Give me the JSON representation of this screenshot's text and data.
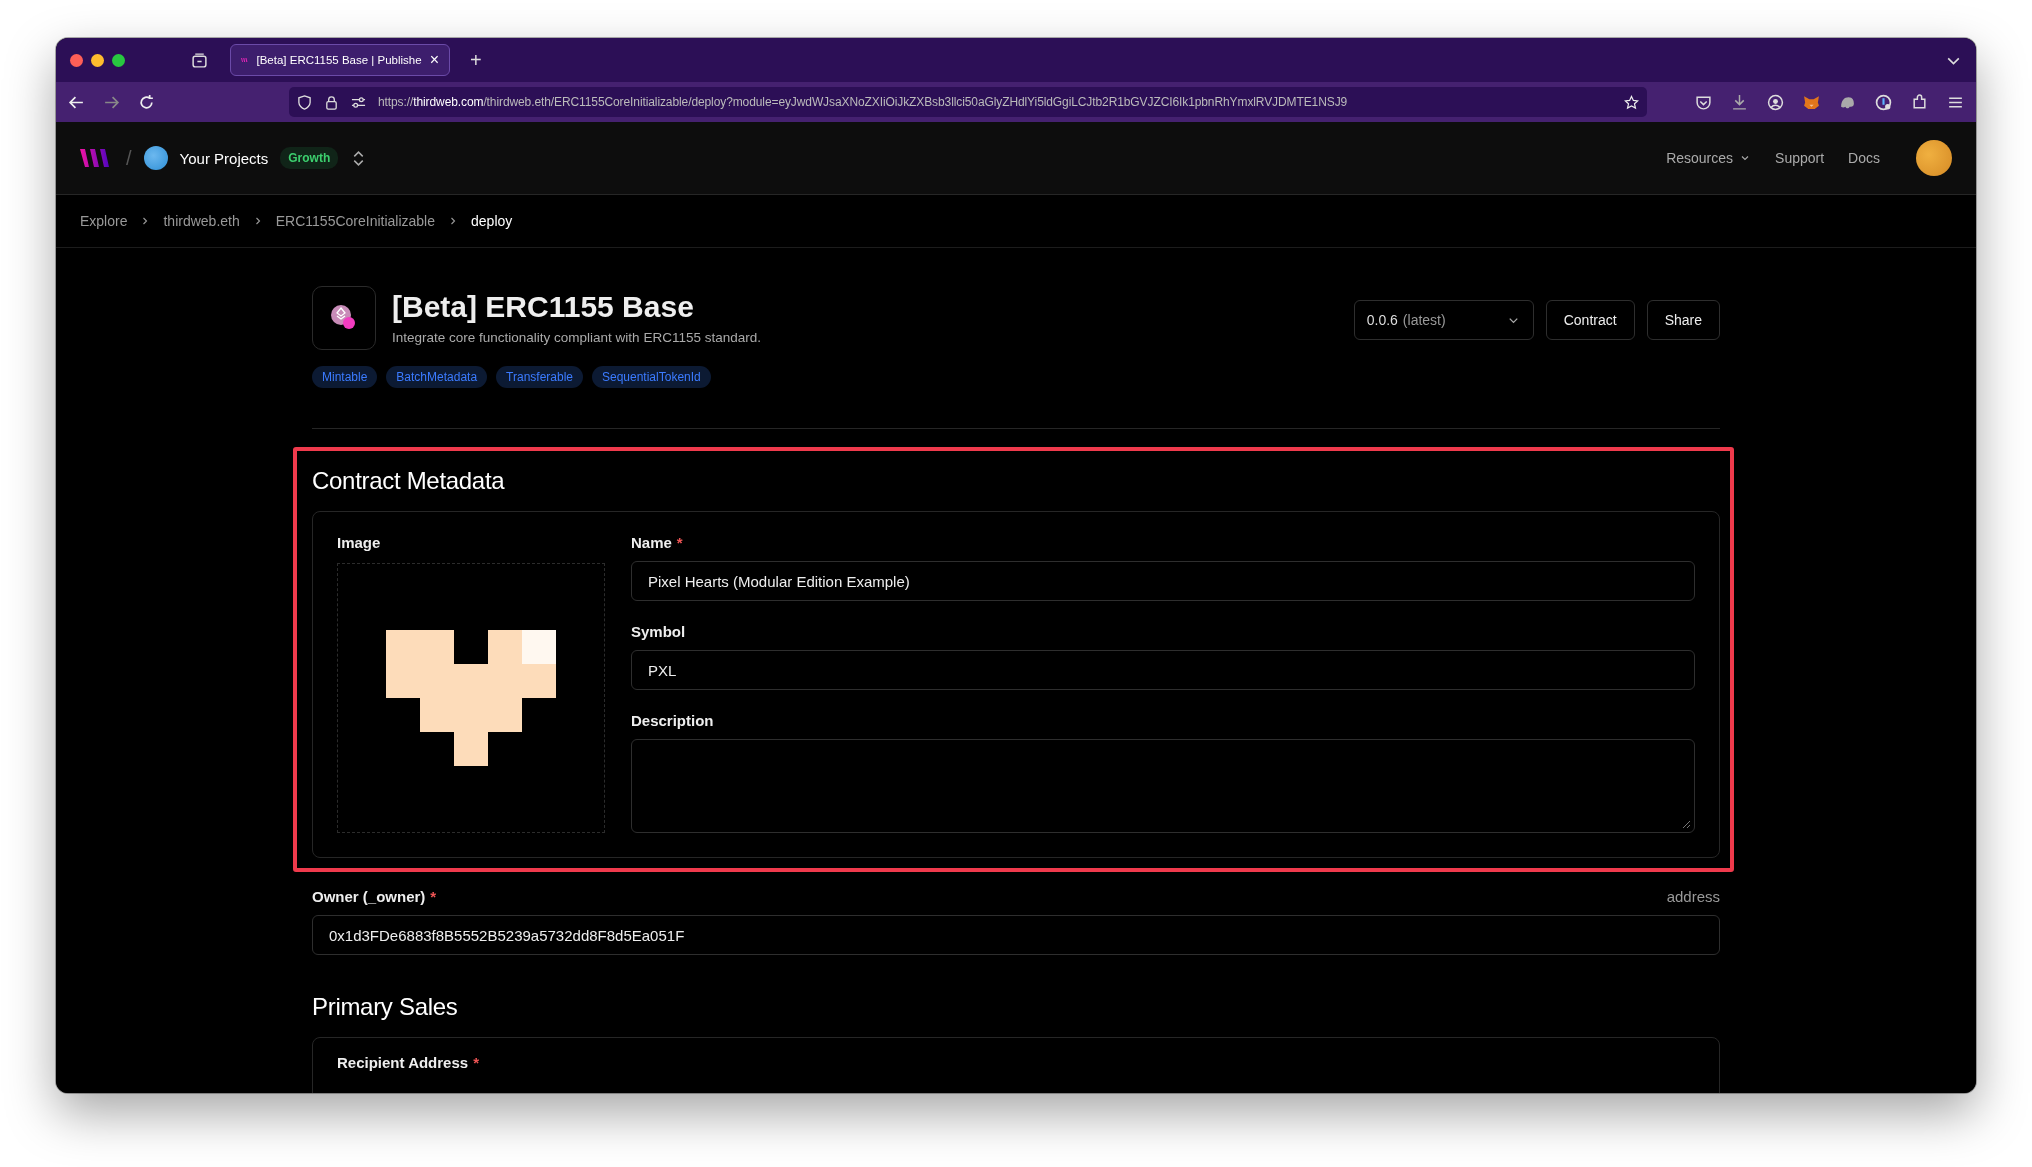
{
  "browser": {
    "tabs": [
      {
        "title": "[Beta] ERC1155 Base | Publishe",
        "close": "×",
        "selected": true
      }
    ],
    "new_tab": "+",
    "url": "https://**thirdweb.com**/thirdweb.eth/ERC1155CoreInitializable/deploy?module=eyJwdWJsaXNoZXIiOiJkZXBsb3llci50aGlyZHdlYi5ldGgiLCJtb2R1bGVJZCI6Ik1pbnRhYmxlRVJDMTE1NSJ9"
  },
  "header": {
    "separator": "/",
    "project": "Your Projects",
    "plan": "Growth",
    "nav": [
      {
        "label": "Resources",
        "dropdown": true
      },
      {
        "label": "Support",
        "dropdown": false
      },
      {
        "label": "Docs",
        "dropdown": false
      }
    ]
  },
  "breadcrumbs": [
    {
      "label": "Explore",
      "selected": false
    },
    {
      "label": "thirdweb.eth",
      "selected": false
    },
    {
      "label": "ERC1155CoreInitializable",
      "selected": false
    },
    {
      "label": "deploy",
      "selected": true
    }
  ],
  "contract": {
    "title": "[Beta] ERC1155 Base",
    "description": "Integrate core functionality compliant with ERC1155 standard.",
    "tags": [
      "Mintable",
      "BatchMetadata",
      "Transferable",
      "SequentialTokenId"
    ],
    "version": {
      "value": "0.0.6",
      "note": "(latest)"
    },
    "buttons": [
      "Contract",
      "Share"
    ]
  },
  "metadata": {
    "title": "Contract Metadata",
    "highlighted": true,
    "image_label": "Image",
    "fields": [
      {
        "kind": "input",
        "label": "Name",
        "required_mark": "*",
        "value": "Pixel Hearts (Modular Edition Example)"
      },
      {
        "kind": "input",
        "label": "Symbol",
        "value": "PXL"
      },
      {
        "kind": "textarea",
        "label": "Description"
      }
    ]
  },
  "owner": {
    "label": "Owner (_owner)",
    "required_mark": "*",
    "type": "address",
    "value": "0x1d3FDe6883f8B5552B5239a5732dd8F8d5Ea051F"
  },
  "primary_sales": {
    "title": "Primary Sales",
    "fields": [
      {
        "label": "Recipient Address",
        "required_mark": "*"
      }
    ]
  }
}
